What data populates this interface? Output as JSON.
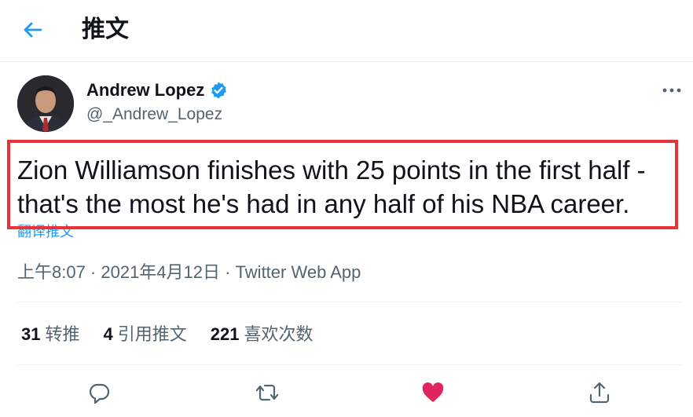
{
  "header": {
    "title": "推文"
  },
  "author": {
    "name": "Andrew Lopez",
    "handle": "@_Andrew_Lopez"
  },
  "tweet": {
    "line1": "Zion Williamson finishes with 25 points in the first half -",
    "line2": "that's the most he's had in any half of his NBA career.",
    "translate_label": "翻译推文"
  },
  "meta": {
    "timestamp": "上午8:07 · 2021年4月12日 · Twitter Web App"
  },
  "stats": [
    {
      "count": "31",
      "label": "转推"
    },
    {
      "count": "4",
      "label": "引用推文"
    },
    {
      "count": "221",
      "label": "喜欢次数"
    }
  ],
  "colors": {
    "accent": "#1d9bf0",
    "like": "#e0245e",
    "highlight": "#e8333a"
  },
  "icons": [
    "back-arrow-icon",
    "verified-badge-icon",
    "more-icon",
    "reply-icon",
    "retweet-icon",
    "like-icon",
    "share-icon"
  ]
}
